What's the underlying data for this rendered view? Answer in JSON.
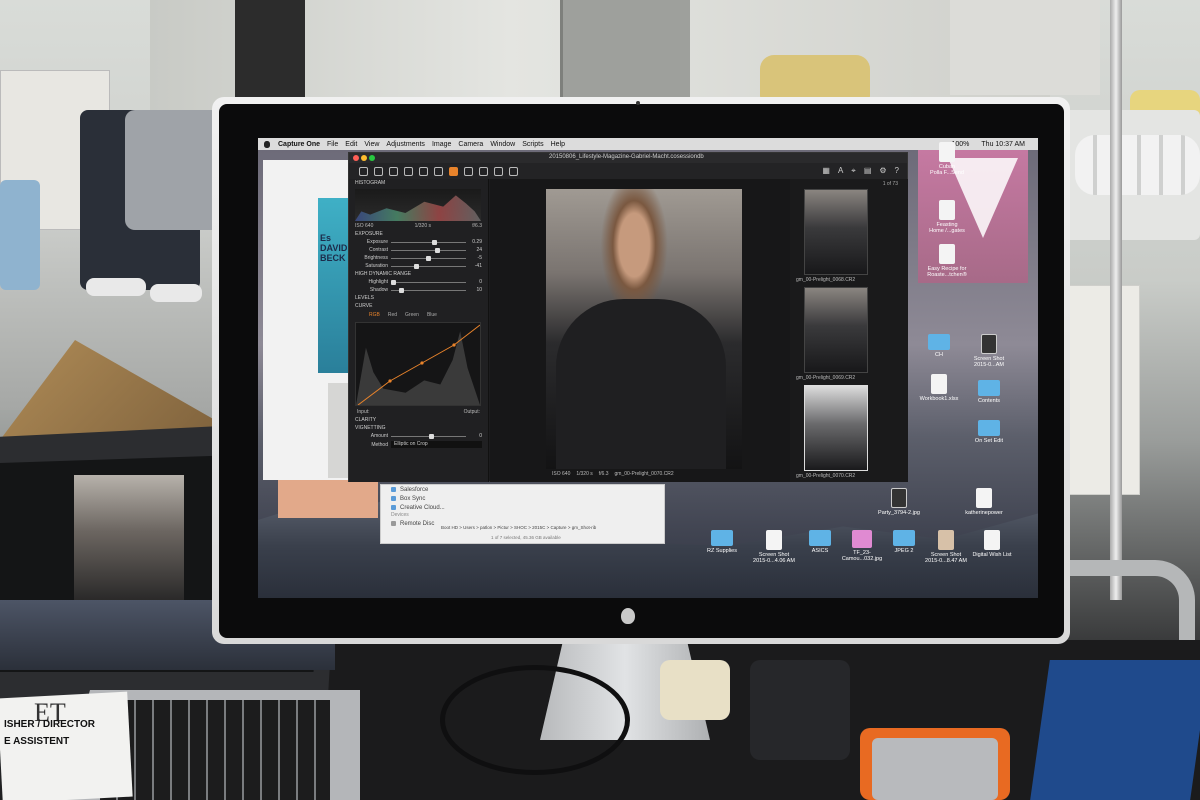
{
  "menubar": {
    "app": "Capture One",
    "items": [
      "File",
      "Edit",
      "View",
      "Adjustments",
      "Image",
      "Camera",
      "Window",
      "Scripts",
      "Help"
    ],
    "battery": "100%",
    "clock": "Thu 10:37 AM"
  },
  "capture_one": {
    "title": "20150806_Lifestyle-Magazine-Gabriel-Macht.cosessiondb",
    "counter": "1 of 73",
    "histogram": {
      "label": "HISTOGRAM",
      "iso": "ISO 640",
      "shutter": "1/320 s",
      "aperture": "f/6.3"
    },
    "exposure": {
      "label": "EXPOSURE",
      "rows": [
        {
          "name": "Exposure",
          "value": "0.29",
          "level": 0.55
        },
        {
          "name": "Contrast",
          "value": "24",
          "level": 0.58
        },
        {
          "name": "Brightness",
          "value": "-5",
          "level": 0.47
        },
        {
          "name": "Saturation",
          "value": "-41",
          "level": 0.3
        }
      ]
    },
    "hdr": {
      "label": "HIGH DYNAMIC RANGE",
      "rows": [
        {
          "name": "Highlight",
          "value": "0",
          "level": 0.0
        },
        {
          "name": "Shadow",
          "value": "10",
          "level": 0.1
        }
      ]
    },
    "levels_label": "LEVELS",
    "curve": {
      "label": "CURVE",
      "tabs": [
        "RGB",
        "Red",
        "Green",
        "Blue"
      ],
      "input": "Input:",
      "output": "Output:"
    },
    "clarity_label": "CLARITY",
    "vignetting": {
      "label": "VIGNETTING",
      "amount_name": "Amount",
      "amount_value": "0",
      "method_name": "Method",
      "method_value": "Elliptic on Crop"
    },
    "viewer_meta": {
      "iso": "ISO 640",
      "shutter": "1/320 s",
      "aperture": "f/6.3",
      "filename": "gm_00-Prelight_0070.CR2"
    },
    "thumbs": [
      "gm_00-Prelight_0068.CR2",
      "gm_00-Prelight_0069.CR2",
      "gm_00-Prelight_0070.CR2"
    ]
  },
  "finder": {
    "items": [
      "Salesforce",
      "Box Sync",
      "Creative Cloud..."
    ],
    "devices_head": "Devices",
    "device": "Remote Disc",
    "path": "Boot HD  >  Users  >  patlon  >  Pictur  >  SHOC  >  2015C  >  Capture  >  gm_Shot-rib",
    "status": "1 of 7 selected, 45.36 GB available"
  },
  "desktop_icons": [
    {
      "label": "Cuban\nPolla F...Send",
      "kind": "doc"
    },
    {
      "label": "Feasting\nHome /...gates",
      "kind": "doc"
    },
    {
      "label": "Easy Recipe for\nRoaste...tchen®",
      "kind": "doc"
    },
    {
      "label": "CH",
      "kind": "folder"
    },
    {
      "label": "Screen Shot\n2015-0...AM",
      "kind": "dark"
    },
    {
      "label": "Workbook1.xlsx",
      "kind": "doc"
    },
    {
      "label": "Contents",
      "kind": "folder"
    },
    {
      "label": "On Set Edit",
      "kind": "folder"
    },
    {
      "label": "Party_3794-2.jpg",
      "kind": "dark"
    },
    {
      "label": "katherinepower",
      "kind": "doc"
    },
    {
      "label": "RZ Supplies",
      "kind": "folder"
    },
    {
      "label": "Screen Shot\n2015-0...4.06 AM",
      "kind": "doc"
    },
    {
      "label": "ASICS",
      "kind": "folder"
    },
    {
      "label": "TF_23-\nCamou...032.jpg",
      "kind": "pink"
    },
    {
      "label": "JPEG 2",
      "kind": "folder"
    },
    {
      "label": "Screen Shot\n2015-0...8.47 AM",
      "kind": "img"
    },
    {
      "label": "Digital Wish List",
      "kind": "doc"
    }
  ],
  "magazine": {
    "cover_text": "Es\nDAVID\nBECK"
  },
  "laptop_paper": {
    "logo": "ET",
    "line1": "ISHER / DIRECTOR",
    "line2": "E ASSISTENT"
  }
}
